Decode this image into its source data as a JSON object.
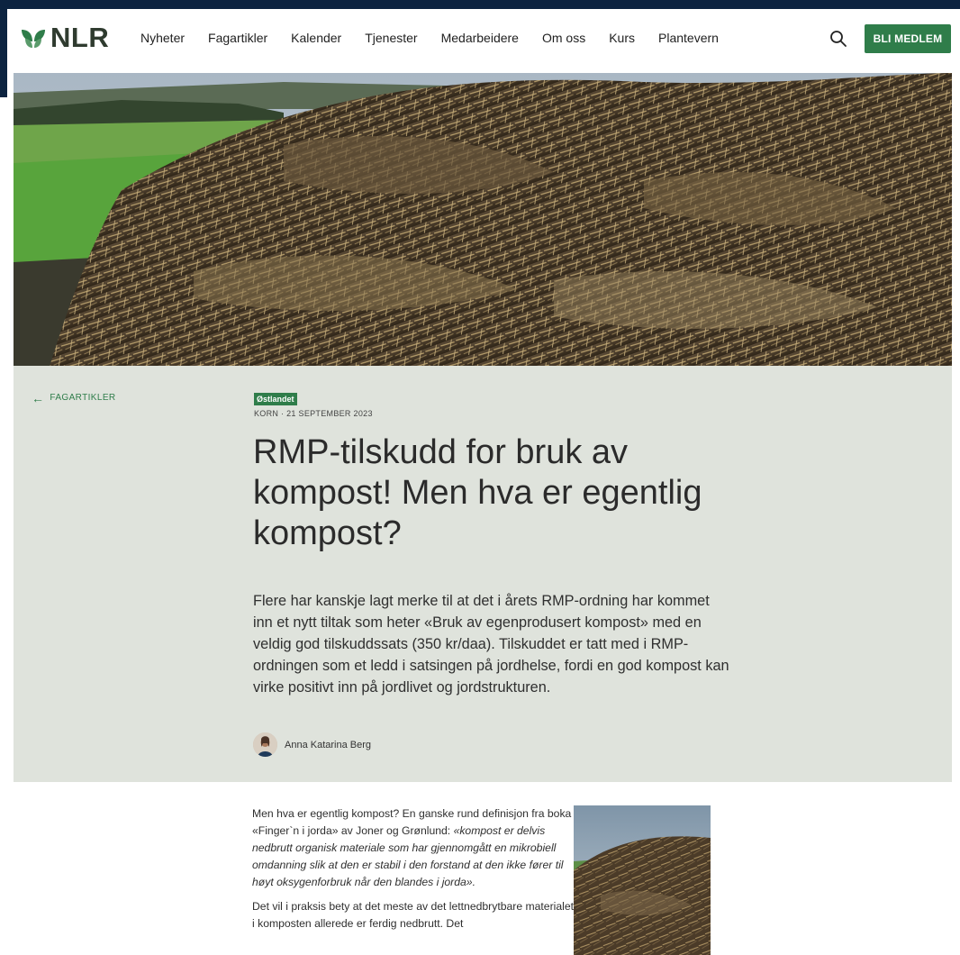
{
  "header": {
    "logo_text": "NLR",
    "nav": [
      "Nyheter",
      "Fagartikler",
      "Kalender",
      "Tjenester",
      "Medarbeidere",
      "Om oss",
      "Kurs",
      "Plantevern"
    ],
    "cta_label": "BLI MEDLEM"
  },
  "article": {
    "back_label": "FAGARTIKLER",
    "region_badge": "Østlandet",
    "meta": "KORN · 21 SEPTEMBER 2023",
    "title": "RMP-tilskudd for bruk av kompost! Men hva er egentlig kompost?",
    "lead": "Flere har kanskje lagt merke til at det i årets RMP-ordning har kommet inn et nytt tiltak som heter «Bruk av egenprodusert kompost» med en veldig god tilskuddssats (350 kr/daa). Tilskuddet er tatt med i RMP-ordningen som et ledd i satsingen på jordhelse, fordi en god kompost kan virke positivt inn på jordlivet og jordstrukturen.",
    "author_name": "Anna Katarina Berg",
    "body_p1_intro": "Men hva er egentlig kompost? En ganske rund definisjon fra boka «Finger`n i jorda» av Joner og Grønlund:",
    "body_p1_quote": "«kompost er delvis nedbrutt organisk materiale som har gjennomgått en mikrobiell omdanning slik at den er stabil i den forstand at den ikke fører til høyt oksygenforbruk når den blandes i jorda».",
    "body_p2": "Det vil i praksis bety at det meste av det lettnedbrytbare materialet i komposten allerede er ferdig nedbrutt. Det"
  },
  "colors": {
    "brand_green": "#2f7d4a",
    "intro_band": "#dfe3dc",
    "frame": "#0c2340"
  },
  "icons": {
    "search": "search-icon",
    "back": "arrow-left-icon",
    "logo": "leaf-logo-icon"
  }
}
